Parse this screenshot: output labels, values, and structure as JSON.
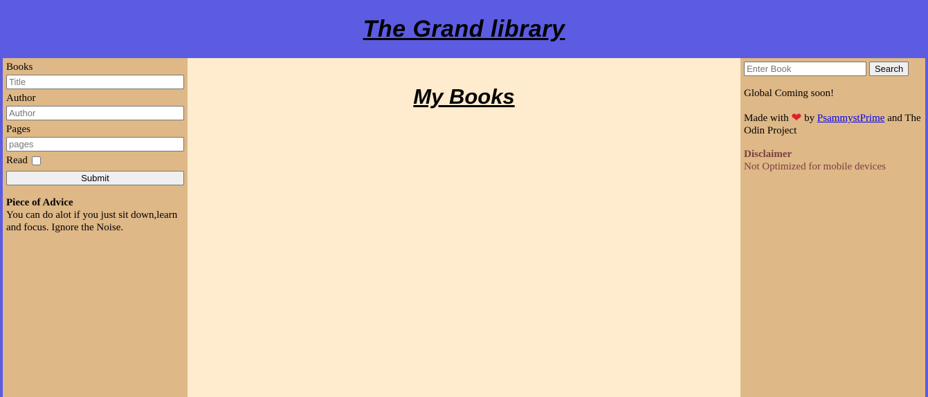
{
  "header": {
    "title": "The Grand library"
  },
  "form": {
    "books_label": "Books",
    "title_placeholder": "Title",
    "author_label": "Author",
    "author_placeholder": "Author",
    "pages_label": "Pages",
    "pages_placeholder": "pages",
    "read_label": "Read",
    "submit_label": "Submit"
  },
  "advice": {
    "heading": "Piece of Advice",
    "text": "You can do alot if you just sit down,learn and focus. Ignore the Noise."
  },
  "main": {
    "heading": "My Books"
  },
  "sidebar": {
    "search_placeholder": "Enter Book",
    "search_button": "Search",
    "global_text": "Global Coming soon!",
    "made_with": "Made with",
    "by": "by",
    "author_link": "PsammystPrime",
    "and_text": "and The Odin Project",
    "disclaimer_heading": "Disclaimer",
    "disclaimer_text": "Not Optimized for mobile devices"
  },
  "colors": {
    "header_bg": "#5b5ce2",
    "sidebar_bg": "#deb887",
    "main_bg": "#ffebcd",
    "disclaimer_text": "#7a3f3f",
    "heart": "#e0202a"
  },
  "icons": {
    "heart": "heart-icon"
  }
}
